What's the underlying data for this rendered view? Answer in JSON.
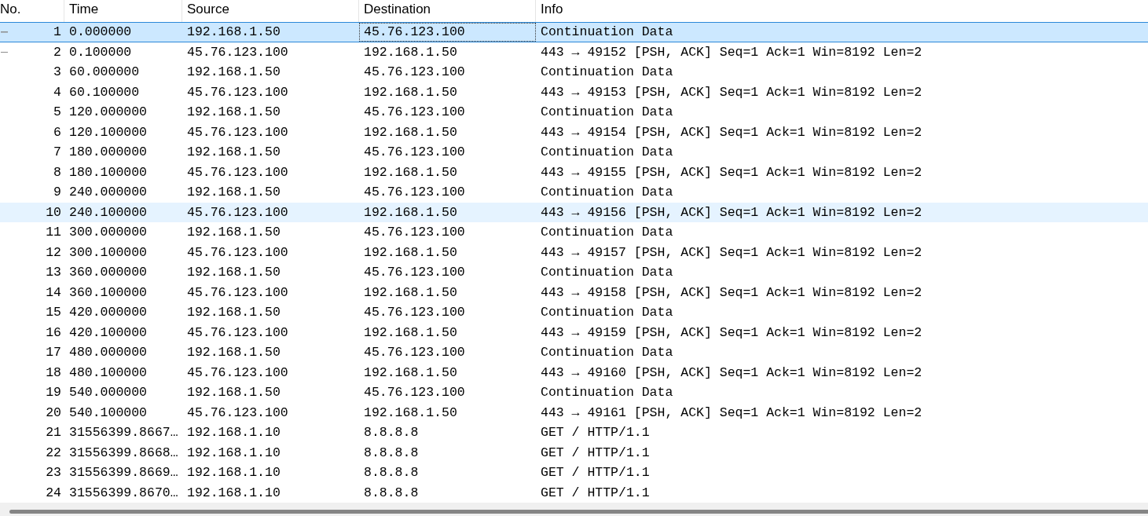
{
  "table": {
    "columns": [
      {
        "label": "No."
      },
      {
        "label": "Time"
      },
      {
        "label": "Source"
      },
      {
        "label": "Destination"
      },
      {
        "label": "Info"
      }
    ],
    "rows": [
      {
        "cells": [
          "1",
          "0.000000",
          "192.168.1.50",
          "45.76.123.100",
          "Continuation Data"
        ],
        "selected": true,
        "hovered": false,
        "related": true,
        "focused_cells": [
          false,
          false,
          false,
          true,
          false
        ]
      },
      {
        "cells": [
          "2",
          "0.100000",
          "45.76.123.100",
          "192.168.1.50",
          "443 → 49152 [PSH, ACK] Seq=1 Ack=1 Win=8192 Len=2"
        ],
        "selected": false,
        "hovered": false,
        "related": true,
        "focused_cells": [
          false,
          false,
          false,
          false,
          false
        ]
      },
      {
        "cells": [
          "3",
          "60.000000",
          "192.168.1.50",
          "45.76.123.100",
          "Continuation Data"
        ],
        "selected": false,
        "hovered": false,
        "related": false,
        "focused_cells": [
          false,
          false,
          false,
          false,
          false
        ]
      },
      {
        "cells": [
          "4",
          "60.100000",
          "45.76.123.100",
          "192.168.1.50",
          "443 → 49153 [PSH, ACK] Seq=1 Ack=1 Win=8192 Len=2"
        ],
        "selected": false,
        "hovered": false,
        "related": false,
        "focused_cells": [
          false,
          false,
          false,
          false,
          false
        ]
      },
      {
        "cells": [
          "5",
          "120.000000",
          "192.168.1.50",
          "45.76.123.100",
          "Continuation Data"
        ],
        "selected": false,
        "hovered": false,
        "related": false,
        "focused_cells": [
          false,
          false,
          false,
          false,
          false
        ]
      },
      {
        "cells": [
          "6",
          "120.100000",
          "45.76.123.100",
          "192.168.1.50",
          "443 → 49154 [PSH, ACK] Seq=1 Ack=1 Win=8192 Len=2"
        ],
        "selected": false,
        "hovered": false,
        "related": false,
        "focused_cells": [
          false,
          false,
          false,
          false,
          false
        ]
      },
      {
        "cells": [
          "7",
          "180.000000",
          "192.168.1.50",
          "45.76.123.100",
          "Continuation Data"
        ],
        "selected": false,
        "hovered": false,
        "related": false,
        "focused_cells": [
          false,
          false,
          false,
          false,
          false
        ]
      },
      {
        "cells": [
          "8",
          "180.100000",
          "45.76.123.100",
          "192.168.1.50",
          "443 → 49155 [PSH, ACK] Seq=1 Ack=1 Win=8192 Len=2"
        ],
        "selected": false,
        "hovered": false,
        "related": false,
        "focused_cells": [
          false,
          false,
          false,
          false,
          false
        ]
      },
      {
        "cells": [
          "9",
          "240.000000",
          "192.168.1.50",
          "45.76.123.100",
          "Continuation Data"
        ],
        "selected": false,
        "hovered": false,
        "related": false,
        "focused_cells": [
          false,
          false,
          false,
          false,
          false
        ]
      },
      {
        "cells": [
          "10",
          "240.100000",
          "45.76.123.100",
          "192.168.1.50",
          "443 → 49156 [PSH, ACK] Seq=1 Ack=1 Win=8192 Len=2"
        ],
        "selected": false,
        "hovered": true,
        "related": false,
        "focused_cells": [
          false,
          false,
          false,
          false,
          false
        ]
      },
      {
        "cells": [
          "11",
          "300.000000",
          "192.168.1.50",
          "45.76.123.100",
          "Continuation Data"
        ],
        "selected": false,
        "hovered": false,
        "related": false,
        "focused_cells": [
          false,
          false,
          false,
          false,
          false
        ]
      },
      {
        "cells": [
          "12",
          "300.100000",
          "45.76.123.100",
          "192.168.1.50",
          "443 → 49157 [PSH, ACK] Seq=1 Ack=1 Win=8192 Len=2"
        ],
        "selected": false,
        "hovered": false,
        "related": false,
        "focused_cells": [
          false,
          false,
          false,
          false,
          false
        ]
      },
      {
        "cells": [
          "13",
          "360.000000",
          "192.168.1.50",
          "45.76.123.100",
          "Continuation Data"
        ],
        "selected": false,
        "hovered": false,
        "related": false,
        "focused_cells": [
          false,
          false,
          false,
          false,
          false
        ]
      },
      {
        "cells": [
          "14",
          "360.100000",
          "45.76.123.100",
          "192.168.1.50",
          "443 → 49158 [PSH, ACK] Seq=1 Ack=1 Win=8192 Len=2"
        ],
        "selected": false,
        "hovered": false,
        "related": false,
        "focused_cells": [
          false,
          false,
          false,
          false,
          false
        ]
      },
      {
        "cells": [
          "15",
          "420.000000",
          "192.168.1.50",
          "45.76.123.100",
          "Continuation Data"
        ],
        "selected": false,
        "hovered": false,
        "related": false,
        "focused_cells": [
          false,
          false,
          false,
          false,
          false
        ]
      },
      {
        "cells": [
          "16",
          "420.100000",
          "45.76.123.100",
          "192.168.1.50",
          "443 → 49159 [PSH, ACK] Seq=1 Ack=1 Win=8192 Len=2"
        ],
        "selected": false,
        "hovered": false,
        "related": false,
        "focused_cells": [
          false,
          false,
          false,
          false,
          false
        ]
      },
      {
        "cells": [
          "17",
          "480.000000",
          "192.168.1.50",
          "45.76.123.100",
          "Continuation Data"
        ],
        "selected": false,
        "hovered": false,
        "related": false,
        "focused_cells": [
          false,
          false,
          false,
          false,
          false
        ]
      },
      {
        "cells": [
          "18",
          "480.100000",
          "45.76.123.100",
          "192.168.1.50",
          "443 → 49160 [PSH, ACK] Seq=1 Ack=1 Win=8192 Len=2"
        ],
        "selected": false,
        "hovered": false,
        "related": false,
        "focused_cells": [
          false,
          false,
          false,
          false,
          false
        ]
      },
      {
        "cells": [
          "19",
          "540.000000",
          "192.168.1.50",
          "45.76.123.100",
          "Continuation Data"
        ],
        "selected": false,
        "hovered": false,
        "related": false,
        "focused_cells": [
          false,
          false,
          false,
          false,
          false
        ]
      },
      {
        "cells": [
          "20",
          "540.100000",
          "45.76.123.100",
          "192.168.1.50",
          "443 → 49161 [PSH, ACK] Seq=1 Ack=1 Win=8192 Len=2"
        ],
        "selected": false,
        "hovered": false,
        "related": false,
        "focused_cells": [
          false,
          false,
          false,
          false,
          false
        ]
      },
      {
        "cells": [
          "21",
          "31556399.8667…",
          "192.168.1.10",
          "8.8.8.8",
          "GET / HTTP/1.1"
        ],
        "selected": false,
        "hovered": false,
        "related": false,
        "focused_cells": [
          false,
          false,
          false,
          false,
          false
        ]
      },
      {
        "cells": [
          "22",
          "31556399.8668…",
          "192.168.1.10",
          "8.8.8.8",
          "GET / HTTP/1.1"
        ],
        "selected": false,
        "hovered": false,
        "related": false,
        "focused_cells": [
          false,
          false,
          false,
          false,
          false
        ]
      },
      {
        "cells": [
          "23",
          "31556399.8669…",
          "192.168.1.10",
          "8.8.8.8",
          "GET / HTTP/1.1"
        ],
        "selected": false,
        "hovered": false,
        "related": false,
        "focused_cells": [
          false,
          false,
          false,
          false,
          false
        ]
      },
      {
        "cells": [
          "24",
          "31556399.8670…",
          "192.168.1.10",
          "8.8.8.8",
          "GET / HTTP/1.1"
        ],
        "selected": false,
        "hovered": false,
        "related": false,
        "focused_cells": [
          false,
          false,
          false,
          false,
          false
        ]
      }
    ]
  }
}
